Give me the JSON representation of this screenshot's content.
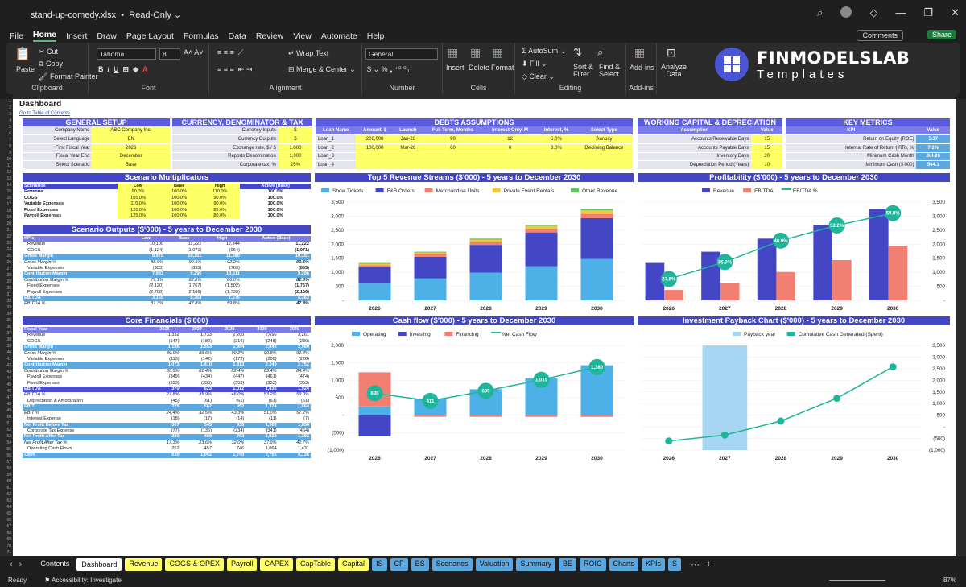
{
  "window": {
    "filename": "stand-up-comedy.xlsx",
    "mode": "Read-Only"
  },
  "menu": [
    "File",
    "Home",
    "Insert",
    "Draw",
    "Page Layout",
    "Formulas",
    "Data",
    "Review",
    "View",
    "Automate",
    "Help"
  ],
  "menu_active": "Home",
  "right_buttons": {
    "comments": "Comments",
    "share": "Share"
  },
  "ribbon": {
    "paste": "Paste",
    "cut": "Cut",
    "copy": "Copy",
    "format_painter": "Format Painter",
    "clipboard": "Clipboard",
    "font_name": "Tahoma",
    "font_size": "8",
    "font": "Font",
    "wrap": "Wrap Text",
    "merge": "Merge & Center",
    "alignment": "Alignment",
    "number_format": "General",
    "number": "Number",
    "insert": "Insert",
    "delete": "Delete",
    "format": "Format",
    "cells": "Cells",
    "autosum": "AutoSum",
    "fill": "Fill",
    "clear": "Clear",
    "sort": "Sort & Filter",
    "find": "Find & Select",
    "editing": "Editing",
    "addins": "Add-ins",
    "addins_group": "Add-ins",
    "analyze": "Analyze Data"
  },
  "logo": {
    "line1": "FINMODELSLAB",
    "line2": "Templates"
  },
  "colors": {
    "accent": "#5b5be0",
    "header": "#4347c6",
    "light_blue": "#5ba8e0",
    "yellow": "#ffff66",
    "teal": "#1fb59a",
    "salmon": "#f28072"
  },
  "dashboard": {
    "title": "Dashboard",
    "toc": "Go to Table of Contents"
  },
  "general_setup": {
    "title": "GENERAL SETUP",
    "rows": [
      [
        "Company Name",
        "ABC Company Inc."
      ],
      [
        "Select Language",
        "EN"
      ],
      [
        "First Fiscal Year",
        "2026"
      ],
      [
        "Fiscal Year End",
        "December"
      ],
      [
        "Select Scenario",
        "Base"
      ]
    ]
  },
  "currency": {
    "title": "CURRENCY, DENOMINATOR & TAX",
    "rows": [
      [
        "Currency Inputs",
        "$"
      ],
      [
        "Currency Outputs",
        "$"
      ],
      [
        "Exchange rate, $ / $",
        "1.000"
      ],
      [
        "Reports Denomination",
        "1,000"
      ],
      [
        "Corporate tax, %",
        "25%"
      ]
    ]
  },
  "debts": {
    "title": "DEBTS ASSUMPTIONS",
    "headers": [
      "Loan Name",
      "Amount, $",
      "Launch",
      "Full Term, Months",
      "Interest-Only, M",
      "Interest, %",
      "Select Type"
    ],
    "rows": [
      [
        "Loan_1",
        "200,000",
        "Jan-26",
        "90",
        "12",
        "6.0%",
        "Annuity"
      ],
      [
        "Loan_2",
        "100,000",
        "Mar-26",
        "60",
        "0",
        "8.0%",
        "Declining Balance"
      ],
      [
        "Loan_3",
        "",
        "",
        "",
        "",
        "",
        ""
      ],
      [
        "Loan_4",
        "",
        "",
        "",
        "",
        "",
        ""
      ]
    ]
  },
  "wc": {
    "title": "WORKING CAPITAL & DEPRECIATION",
    "headers": [
      "Assumption",
      "Value"
    ],
    "rows": [
      [
        "Accounts Receivable Days",
        "15"
      ],
      [
        "Accounts Payable Days",
        "15"
      ],
      [
        "Inventory Days",
        "20"
      ],
      [
        "Depreciation Period (Years)",
        "10"
      ]
    ]
  },
  "metrics": {
    "title": "KEY METRICS",
    "headers": [
      "KPI",
      "Value"
    ],
    "rows": [
      [
        "Return on Equity (ROE)",
        "5.37"
      ],
      [
        "Internal Rate of Return (IRR), %",
        "7.3%"
      ],
      [
        "Minimum Cash Month",
        "Jul-26"
      ],
      [
        "Minimum Cash ($'000)",
        "544.1"
      ]
    ]
  },
  "multipliers": {
    "title": "Scenario Multiplicators",
    "headers": [
      "Scenarios",
      "Low",
      "Base",
      "High",
      "Active (Base)"
    ],
    "rows": [
      [
        "Revenue",
        "90.0%",
        "100.0%",
        "110.0%",
        "100.0%"
      ],
      [
        "COGS",
        "105.0%",
        "100.0%",
        "90.0%",
        "100.0%"
      ],
      [
        "Variable Expenses",
        "115.0%",
        "100.0%",
        "90.0%",
        "100.0%"
      ],
      [
        "Fixed Expenses",
        "120.0%",
        "100.0%",
        "85.0%",
        "100.0%"
      ],
      [
        "Payroll Expenses",
        "125.0%",
        "100.0%",
        "80.0%",
        "100.0%"
      ]
    ]
  },
  "outputs": {
    "title": "Scenario Outputs ($'000) - 5 years to December 2030",
    "headers": [
      "KPIs",
      "Low",
      "Base",
      "High",
      "Active (Base)"
    ],
    "rows": [
      [
        "Revenue",
        "10,100",
        "11,222",
        "12,344",
        "11,222",
        ""
      ],
      [
        "COGS",
        "(1,124)",
        "(1,071)",
        "(964)",
        "(1,071)",
        ""
      ],
      [
        "Gross Margin",
        "8,975",
        "10,151",
        "11,380",
        "10,151",
        "hl1"
      ],
      [
        "Gross Margin %",
        "88.9%",
        "90.5%",
        "92.2%",
        "90.5%",
        "i"
      ],
      [
        "Variable Expenses",
        "(983)",
        "(855)",
        "(769)",
        "(855)",
        ""
      ],
      [
        "Contribution Margin",
        "7,993",
        "9,296",
        "10,611",
        "9,296",
        "hl1"
      ],
      [
        "Contribution Margin %",
        "79.1%",
        "82.8%",
        "86.0%",
        "82.8%",
        "i"
      ],
      [
        "Fixed Expenses",
        "(2,120)",
        "(1,767)",
        "(1,502)",
        "(1,767)",
        ""
      ],
      [
        "Payroll Expenses",
        "(2,708)",
        "(2,166)",
        "(1,733)",
        "(2,166)",
        ""
      ],
      [
        "EBITDA",
        "3,165",
        "5,363",
        "7,376",
        "5,363",
        "hl1"
      ],
      [
        "EBITDA %",
        "31.3%",
        "47.8%",
        "59.8%",
        "47.8%",
        "i"
      ]
    ]
  },
  "core": {
    "title": "Core Financials ($'000)",
    "headers": [
      "Fiscal Year",
      "2026",
      "2027",
      "2028",
      "2029",
      "2030"
    ],
    "rows": [
      [
        "Revenue",
        "1,332",
        "1,733",
        "2,200",
        "2,696",
        "3,261",
        ""
      ],
      [
        "COGS",
        "(147)",
        "(180)",
        "(216)",
        "(248)",
        "(280)",
        ""
      ],
      [
        "Gross Margin",
        "1,186",
        "1,553",
        "1,984",
        "2,448",
        "2,980",
        "hl1"
      ],
      [
        "Gross Margin %",
        "89.0%",
        "89.6%",
        "90.2%",
        "90.8%",
        "91.4%",
        "i"
      ],
      [
        "Variable Expenses",
        "(113)",
        "(142)",
        "(172)",
        "(200)",
        "(228)",
        ""
      ],
      [
        "Contribution Margin",
        "1,073",
        "1,410",
        "1,813",
        "2,249",
        "2,752",
        "hl1"
      ],
      [
        "Contribution Margin %",
        "80.5%",
        "81.4%",
        "82.4%",
        "83.4%",
        "84.4%",
        "i"
      ],
      [
        "Payroll Expenses",
        "(349)",
        "(434)",
        "(447)",
        "(461)",
        "(474)",
        ""
      ],
      [
        "Fixed Expenses",
        "(353)",
        "(353)",
        "(353)",
        "(353)",
        "(353)",
        ""
      ],
      [
        "EBITDA",
        "370",
        "623",
        "1,012",
        "1,435",
        "1,924",
        "hl2"
      ],
      [
        "EBITDA %",
        "27.8%",
        "35.9%",
        "46.0%",
        "53.2%",
        "59.0%",
        "i"
      ],
      [
        "Depreciation & Amortization",
        "(45)",
        "(61)",
        "(61)",
        "(61)",
        "(61)",
        ""
      ],
      [
        "EBIT",
        "325",
        "562",
        "952",
        "1,374",
        "1,864",
        "hl1"
      ],
      [
        "EBIT %",
        "24.4%",
        "32.5%",
        "43.3%",
        "51.0%",
        "57.2%",
        "i"
      ],
      [
        "Interest Expense",
        "(18)",
        "(17)",
        "(14)",
        "(11)",
        "(7)",
        ""
      ],
      [
        "Net Profit Before Tax",
        "307",
        "545",
        "938",
        "1,363",
        "1,856",
        "hl1"
      ],
      [
        "Corporate Tax Expense",
        "(77)",
        "(136)",
        "(234)",
        "(341)",
        "(464)",
        ""
      ],
      [
        "Net Profit After Tax",
        "230",
        "409",
        "703",
        "1,023",
        "1,392",
        "hl1"
      ],
      [
        "Net Profit After Tax %",
        "17.3%",
        "23.6%",
        "32.0%",
        "37.9%",
        "42.7%",
        "i"
      ],
      [
        "Operating Cash Flows",
        "252",
        "457",
        "746",
        "1,064",
        "1,431",
        ""
      ],
      [
        "Cash",
        "630",
        "1,042",
        "1,740",
        "2,755",
        "4,136",
        "hl1"
      ]
    ]
  },
  "chart_data": [
    {
      "type": "bar",
      "title": "Top 5 Revenue Streams ($'000) - 5 years to December 2030",
      "stacked": true,
      "categories": [
        "2026",
        "2027",
        "2028",
        "2029",
        "2030"
      ],
      "series": [
        {
          "name": "Show Tickets",
          "color": "#4db1e8",
          "values": [
            600,
            780,
            990,
            1215,
            1470
          ]
        },
        {
          "name": "F&B Orders",
          "color": "#4347c6",
          "values": [
            590,
            775,
            985,
            1205,
            1460
          ]
        },
        {
          "name": "Merchandise Units",
          "color": "#f28072",
          "values": [
            60,
            80,
            100,
            120,
            150
          ]
        },
        {
          "name": "Private Event Rentals",
          "color": "#f5c542",
          "values": [
            55,
            70,
            90,
            110,
            130
          ]
        },
        {
          "name": "Other Revenue",
          "color": "#5ec45e",
          "values": [
            27,
            28,
            35,
            46,
            51
          ]
        }
      ],
      "yticks": [
        "-",
        "500",
        "1,000",
        "1,500",
        "2,000",
        "2,500",
        "3,000",
        "3,500"
      ],
      "ylim": [
        0,
        3500
      ],
      "legend": "top"
    },
    {
      "type": "bar",
      "title": "Profitability ($'000) - 5 years to December 2030",
      "categories": [
        "2026",
        "2027",
        "2028",
        "2029",
        "2030"
      ],
      "series": [
        {
          "name": "Revenue",
          "color": "#4347c6",
          "values": [
            1332,
            1733,
            2200,
            2696,
            3261
          ]
        },
        {
          "name": "EBITDA",
          "color": "#f28072",
          "values": [
            370,
            623,
            1012,
            1435,
            1924
          ]
        },
        {
          "name": "EBITDA %",
          "type": "line",
          "color": "#1fb59a",
          "values": [
            27.8,
            35.9,
            46.0,
            53.2,
            59.0
          ],
          "labels": [
            "27.8%",
            "35.9%",
            "46.0%",
            "53.2%",
            "59.0%"
          ]
        }
      ],
      "yticks": [
        "-",
        "500",
        "1,000",
        "1,500",
        "2,000",
        "2,500",
        "3,000",
        "3,500"
      ],
      "ylim": [
        0,
        3500
      ],
      "legend": "top"
    },
    {
      "type": "bar",
      "title": "Cash flow ($'000) - 5 years to December 2030",
      "stacked": true,
      "categories": [
        "2026",
        "2027",
        "2028",
        "2029",
        "2030"
      ],
      "series": [
        {
          "name": "Operating",
          "color": "#4db1e8",
          "values": [
            252,
            457,
            746,
            1064,
            1431
          ]
        },
        {
          "name": "Investing",
          "color": "#4347c6",
          "values": [
            -600,
            0,
            0,
            0,
            0
          ]
        },
        {
          "name": "Financing",
          "color": "#f28072",
          "values": [
            978,
            -46,
            -48,
            -49,
            -50
          ]
        },
        {
          "name": "Net Cash Flow",
          "type": "line",
          "color": "#1fb59a",
          "values": [
            630,
            411,
            699,
            1015,
            1380
          ],
          "labels": [
            "630",
            "411",
            "699",
            "1,015",
            "1,380"
          ]
        }
      ],
      "yticks": [
        "(1,000)",
        "(500)",
        "-",
        "500",
        "1,000",
        "1,500",
        "2,000"
      ],
      "ylim": [
        -1000,
        2000
      ],
      "legend": "top"
    },
    {
      "type": "line",
      "title": "Investment Payback Chart ($'000) - 5 years to December 2030",
      "categories": [
        "2026",
        "2027",
        "2028",
        "2029",
        "2030"
      ],
      "series": [
        {
          "name": "Payback year",
          "type": "bar",
          "color": "#a6d6f2",
          "values": [
            0,
            1,
            0,
            0,
            0
          ]
        },
        {
          "name": "Cumulative Cash Generated (Spent)",
          "color": "#1fb59a",
          "values": [
            -610,
            -350,
            250,
            1230,
            2580
          ]
        }
      ],
      "yticks": [
        "(1,000)",
        "(500)",
        "-",
        "500",
        "1,000",
        "1,500",
        "2,000",
        "2,500",
        "3,000",
        "3,500"
      ],
      "ylim": [
        -1000,
        3500
      ],
      "legend": "top"
    }
  ],
  "sheet_tabs": [
    {
      "label": "Contents",
      "bg": "#1f1f1f",
      "fg": "#e8e8e8"
    },
    {
      "label": "Dashboard",
      "bg": "#ffffff",
      "fg": "#111"
    },
    {
      "label": "Revenue",
      "bg": "#ffff66",
      "fg": "#111"
    },
    {
      "label": "COGS & OPEX",
      "bg": "#ffff66",
      "fg": "#111"
    },
    {
      "label": "Payroll",
      "bg": "#ffff66",
      "fg": "#111"
    },
    {
      "label": "CAPEX",
      "bg": "#ffff66",
      "fg": "#111"
    },
    {
      "label": "CapTable",
      "bg": "#ffff66",
      "fg": "#111"
    },
    {
      "label": "Capital",
      "bg": "#ffff66",
      "fg": "#111"
    },
    {
      "label": "IS",
      "bg": "#5ba8e0",
      "fg": "#111"
    },
    {
      "label": "CF",
      "bg": "#5ba8e0",
      "fg": "#111"
    },
    {
      "label": "BS",
      "bg": "#5ba8e0",
      "fg": "#111"
    },
    {
      "label": "Scenarios",
      "bg": "#5ba8e0",
      "fg": "#111"
    },
    {
      "label": "Valuation",
      "bg": "#5ba8e0",
      "fg": "#111"
    },
    {
      "label": "Summary",
      "bg": "#5ba8e0",
      "fg": "#111"
    },
    {
      "label": "BE",
      "bg": "#5ba8e0",
      "fg": "#111"
    },
    {
      "label": "ROIC",
      "bg": "#5ba8e0",
      "fg": "#111"
    },
    {
      "label": "Charts",
      "bg": "#5ba8e0",
      "fg": "#111"
    },
    {
      "label": "KPIs",
      "bg": "#5ba8e0",
      "fg": "#111"
    },
    {
      "label": "S",
      "bg": "#5ba8e0",
      "fg": "#111"
    }
  ],
  "status": {
    "ready": "Ready",
    "accessibility": "Accessibility: Investigate",
    "zoom": "87%"
  }
}
